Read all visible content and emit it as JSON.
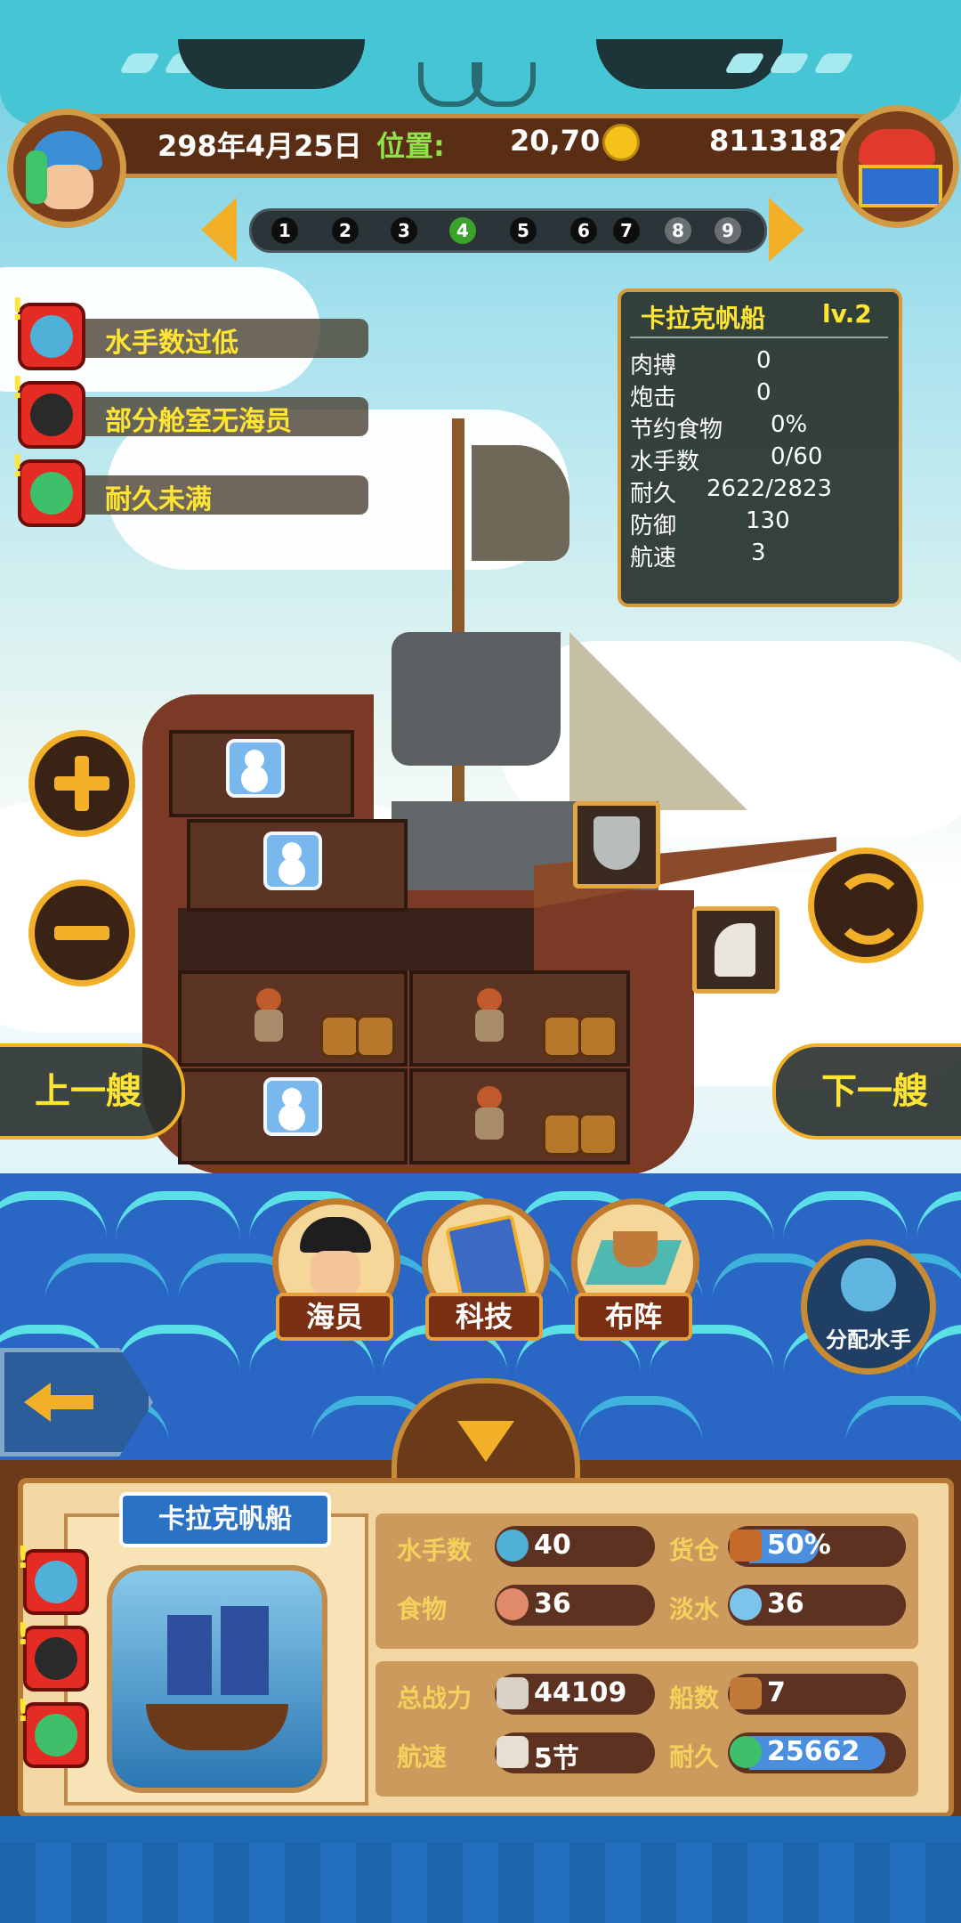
{
  "header": {
    "date": "298年4月25日",
    "position_label": "位置:",
    "position_value": "20,70",
    "gold": "8113182"
  },
  "pager": {
    "pages": [
      "1",
      "2",
      "3",
      "4",
      "5",
      "6",
      "7",
      "8",
      "9"
    ],
    "active": "4"
  },
  "warnings": [
    {
      "text": "水手数过低",
      "icon": "sailor-icon"
    },
    {
      "text": "部分舱室无海员",
      "icon": "pirate-captain-icon"
    },
    {
      "text": "耐久未满",
      "icon": "ship-repair-icon"
    }
  ],
  "ship_info": {
    "name": "卡拉克帆船",
    "level": "lv.2",
    "rows": [
      {
        "label": "肉搏",
        "value": "0"
      },
      {
        "label": "炮击",
        "value": "0"
      },
      {
        "label": "节约食物",
        "value": "0%"
      },
      {
        "label": "水手数",
        "value": "0/60"
      },
      {
        "label": "耐久",
        "value": "2622/2823"
      },
      {
        "label": "防御",
        "value": "130"
      },
      {
        "label": "航速",
        "value": "3"
      }
    ]
  },
  "nav": {
    "prev_ship": "上一艘",
    "next_ship": "下一艘"
  },
  "menu": {
    "crew": "海员",
    "tech": "科技",
    "formation": "布阵",
    "assign_sailors": "分配水手"
  },
  "fleet": {
    "ship_name": "卡拉克帆船",
    "stats": {
      "sailors_label": "水手数",
      "sailors_value": "40",
      "cargo_label": "货仓",
      "cargo_value": "50%",
      "cargo_fill": 0.5,
      "food_label": "食物",
      "food_value": "36",
      "water_label": "淡水",
      "water_value": "36",
      "power_label": "总战力",
      "power_value": "44109",
      "ships_label": "船数",
      "ships_value": "7",
      "speed_label": "航速",
      "speed_value": "5节",
      "durability_label": "耐久",
      "durability_value": "25662",
      "durability_fill": 0.9
    }
  },
  "colors": {
    "accent_yellow": "#ffe533",
    "banner_teal": "#46c6d4",
    "wood_brown": "#5a2e14",
    "warning_red": "#e42c24",
    "active_page_green": "#3aa42a"
  }
}
